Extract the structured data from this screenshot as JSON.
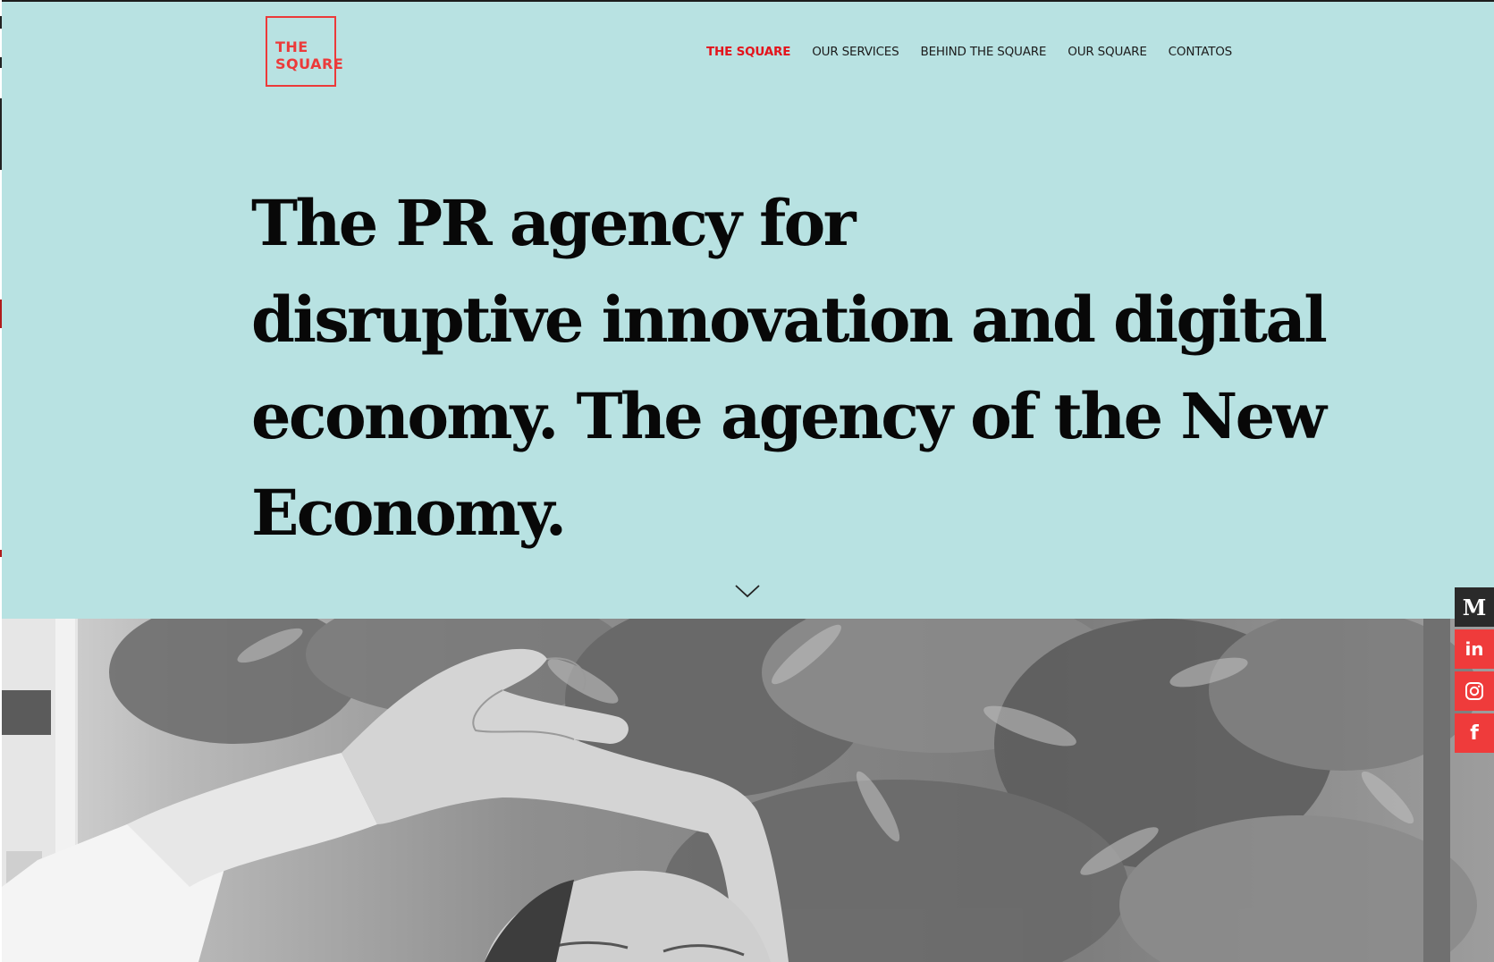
{
  "logo": {
    "line1": "THE",
    "line2": "SQUARE",
    "color": "#ec3a3a"
  },
  "nav": {
    "items": [
      {
        "label": "THE SQUARE",
        "active": true
      },
      {
        "label": "OUR SERVICES",
        "active": false
      },
      {
        "label": "BEHIND THE SQUARE",
        "active": false
      },
      {
        "label": "OUR SQUARE",
        "active": false
      },
      {
        "label": "CONTATOS",
        "active": false
      }
    ],
    "active_color": "#e3141c"
  },
  "hero": {
    "lines": [
      "The PR agency for",
      "disruptive innovation and digital",
      "economy. The agency of the New",
      "Economy."
    ],
    "background": "#b8e2e2"
  },
  "scroll_icon": "chevron-down-icon",
  "social": [
    {
      "name": "medium-icon",
      "glyph": "M"
    },
    {
      "name": "linkedin-icon",
      "glyph": "in"
    },
    {
      "name": "instagram-icon"
    },
    {
      "name": "facebook-icon",
      "glyph": "f"
    }
  ]
}
